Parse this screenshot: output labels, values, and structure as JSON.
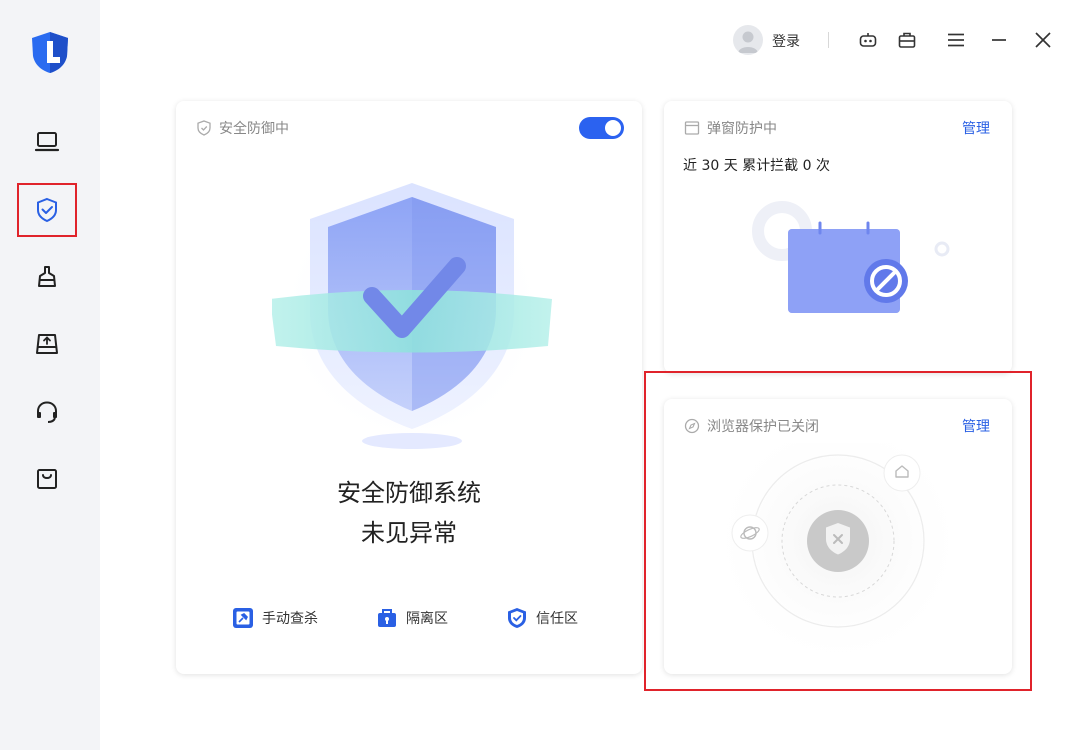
{
  "titlebar": {
    "login_label": "登录"
  },
  "sidebar": {
    "items": [
      {
        "icon": "laptop-icon"
      },
      {
        "icon": "shield-check-icon",
        "active": true
      },
      {
        "icon": "broom-icon"
      },
      {
        "icon": "drive-upload-icon"
      },
      {
        "icon": "headset-icon"
      },
      {
        "icon": "shopping-bag-icon"
      }
    ]
  },
  "defense_card": {
    "header": "安全防御中",
    "toggle_on": true,
    "status_line1": "安全防御系统",
    "status_line2": "未见异常",
    "actions": [
      {
        "label": "手动查杀",
        "icon": "manual-scan-icon"
      },
      {
        "label": "隔离区",
        "icon": "quarantine-icon"
      },
      {
        "label": "信任区",
        "icon": "trust-zone-icon"
      }
    ]
  },
  "popup_card": {
    "header": "弹窗防护中",
    "manage_label": "管理",
    "stat": "近 30 天 累计拦截 0 次"
  },
  "browser_card": {
    "header": "浏览器保护已关闭",
    "manage_label": "管理"
  },
  "colors": {
    "accent": "#2a60e4",
    "highlight": "#e0232b",
    "sidebar_bg": "#f3f4f7"
  }
}
